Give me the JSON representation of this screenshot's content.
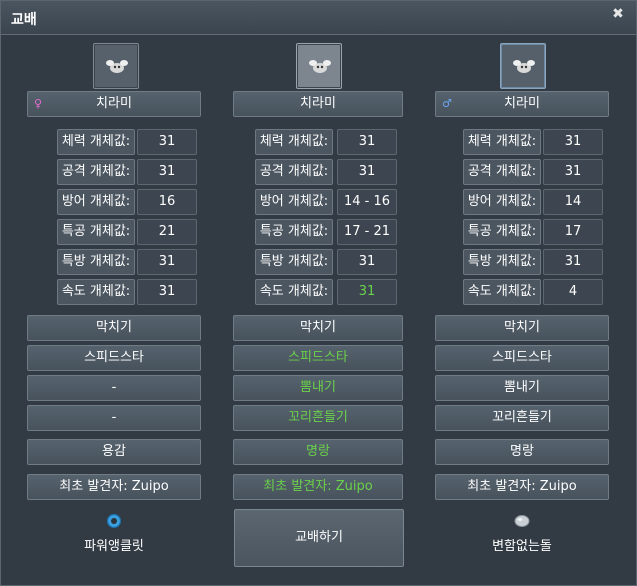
{
  "window": {
    "title": "교배",
    "close_icon": "close-icon"
  },
  "colors": {
    "highlight_green": "#6ad14a",
    "female": "#e36bd2",
    "male": "#6aa5f0"
  },
  "columns": [
    {
      "portrait_icon": "pokemon-portrait-icon",
      "gender_symbol": "♀",
      "name": "치라미",
      "ivs": [
        {
          "label": "체력 개체값:",
          "value": "31"
        },
        {
          "label": "공격 개체값:",
          "value": "31"
        },
        {
          "label": "방어 개체값:",
          "value": "16"
        },
        {
          "label": "특공 개체값:",
          "value": "21"
        },
        {
          "label": "특방 개체값:",
          "value": "31"
        },
        {
          "label": "속도 개체값:",
          "value": "31"
        }
      ],
      "moves": [
        "막치기",
        "스피드스타",
        "-",
        "-"
      ],
      "nature": "용감",
      "discoverer": "최초 발견자: Zuipo",
      "item_icon": "power-anklet-icon",
      "item": "파워앵클릿"
    },
    {
      "portrait_icon": "pokemon-portrait-icon",
      "gender_symbol": "",
      "name": "치라미",
      "ivs": [
        {
          "label": "체력 개체값:",
          "value": "31"
        },
        {
          "label": "공격 개체값:",
          "value": "31"
        },
        {
          "label": "방어 개체값:",
          "value": "14 - 16"
        },
        {
          "label": "특공 개체값:",
          "value": "17 - 21"
        },
        {
          "label": "특방 개체값:",
          "value": "31"
        },
        {
          "label": "속도 개체값:",
          "value": "31"
        }
      ],
      "moves": [
        "막치기",
        "스피드스타",
        "뽐내기",
        "꼬리흔들기"
      ],
      "nature": "명랑",
      "discoverer": "최초 발견자: Zuipo",
      "breed_button": "교배하기"
    },
    {
      "portrait_icon": "pokemon-portrait-icon",
      "gender_symbol": "♂",
      "name": "치라미",
      "ivs": [
        {
          "label": "체력 개체값:",
          "value": "31"
        },
        {
          "label": "공격 개체값:",
          "value": "31"
        },
        {
          "label": "방어 개체값:",
          "value": "14"
        },
        {
          "label": "특공 개체값:",
          "value": "17"
        },
        {
          "label": "특방 개체값:",
          "value": "31"
        },
        {
          "label": "속도 개체값:",
          "value": "4"
        }
      ],
      "moves": [
        "막치기",
        "스피드스타",
        "뽐내기",
        "꼬리흔들기"
      ],
      "nature": "명랑",
      "discoverer": "최초 발견자: Zuipo",
      "item_icon": "everstone-icon",
      "item": "변함없는돌"
    }
  ]
}
